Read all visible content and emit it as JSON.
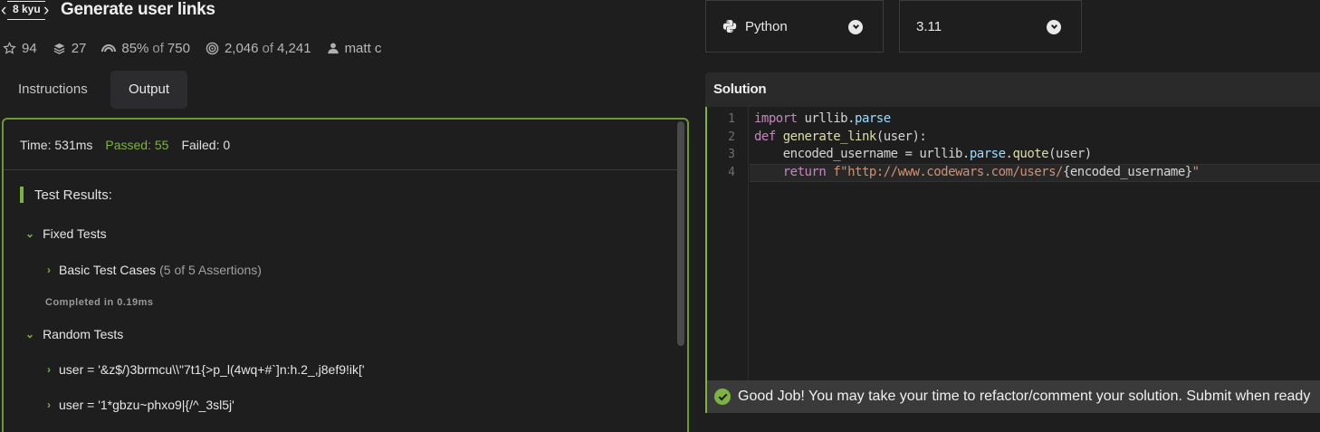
{
  "kata": {
    "rank": "8 kyu",
    "title": "Generate user links"
  },
  "stats": {
    "stars": "94",
    "collections": "27",
    "satisfaction_pct": "85%",
    "satisfaction_of": "of",
    "satisfaction_total": "750",
    "completed": "2,046",
    "completed_of": "of",
    "completed_total": "4,241",
    "author": "matt c"
  },
  "tabs": {
    "instructions": "Instructions",
    "output": "Output"
  },
  "output": {
    "time": "Time: 531ms",
    "passed": "Passed: 55",
    "failed": "Failed: 0",
    "results_heading": "Test Results:",
    "groups": [
      {
        "name": "Fixed Tests",
        "children": [
          {
            "name": "Basic Test Cases",
            "assertions": "(5 of 5 Assertions)"
          }
        ],
        "completed": "Completed in 0.19ms"
      },
      {
        "name": "Random Tests",
        "children": [
          {
            "name": "user = '&z$/)3brmcu\\\\\"7t1{>p_l(4wq+#`]n:h.2_,j8ef9!ik['"
          },
          {
            "name": "user = '1*gbzu~phxo9|{/^_3sl5j'"
          }
        ]
      }
    ]
  },
  "language_select": {
    "value": "Python",
    "icon": "python-icon"
  },
  "version_select": {
    "value": "3.11"
  },
  "solution": {
    "heading": "Solution",
    "line_numbers": [
      "1",
      "2",
      "3",
      "4"
    ],
    "code": {
      "l1": {
        "kw": "import",
        "mod": " urllib.",
        "prop": "parse"
      },
      "l2": {
        "kw": "def",
        "fn": " generate_link",
        "rest": "(user):"
      },
      "l3": {
        "a": "    encoded_username = urllib.",
        "prop1": "parse",
        "dot": ".",
        "fn": "quote",
        "rest": "(user)"
      },
      "l4": {
        "indent": "    ",
        "kw": "return",
        "str1": " f\"http://www.codewars.com/users/",
        "expr": "{encoded_username}",
        "str2": "\""
      }
    }
  },
  "status": {
    "message": "Good Job! You may take your time to refactor/comment your solution. Submit when ready"
  },
  "colors": {
    "accent_green": "#7cb342",
    "background": "#1e1e1e"
  }
}
